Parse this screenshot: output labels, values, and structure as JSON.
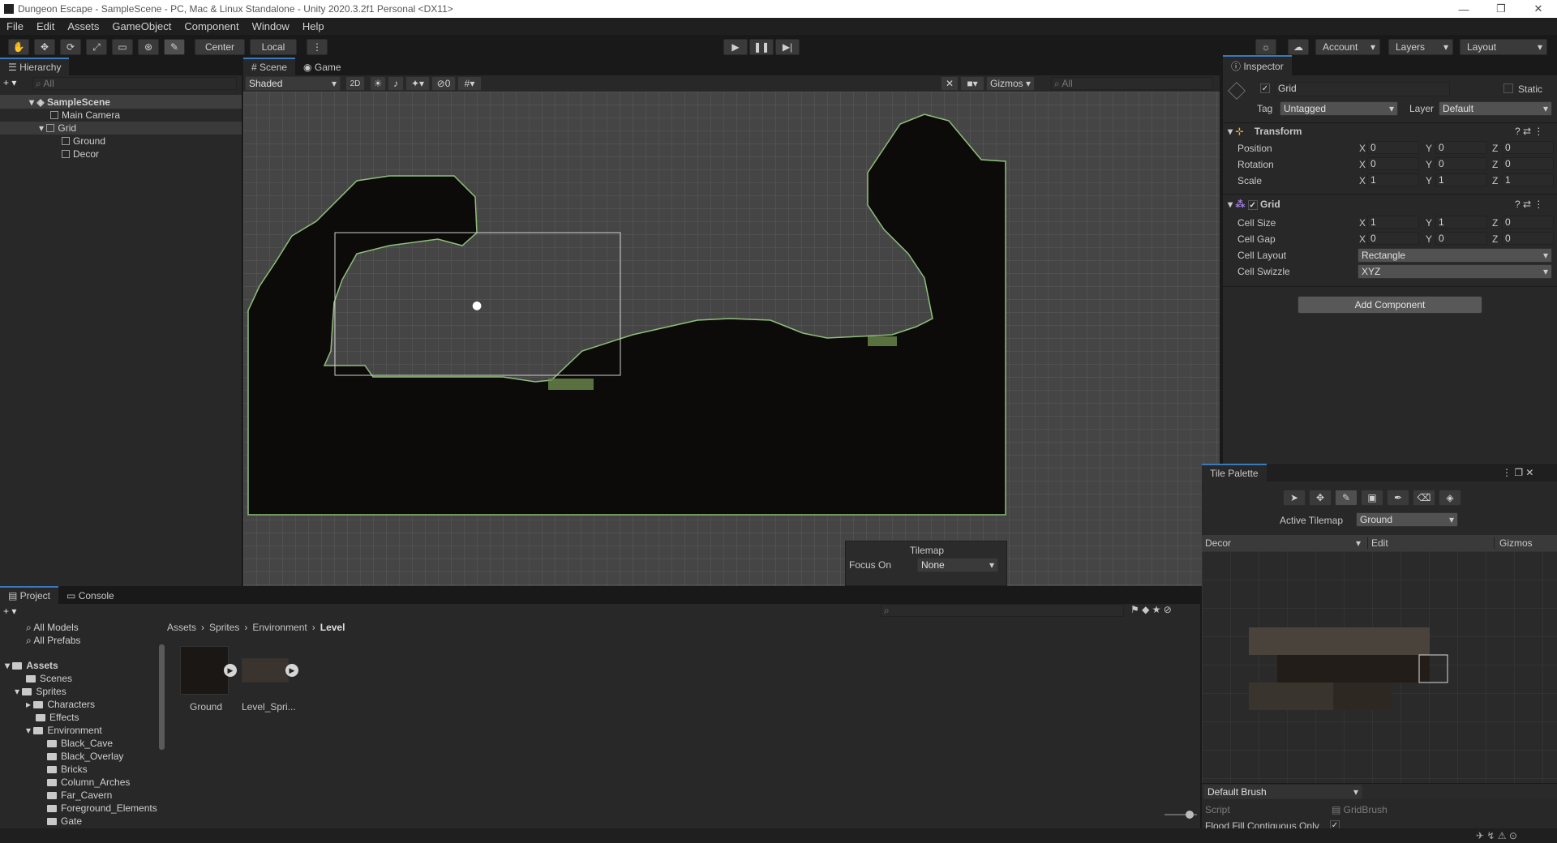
{
  "window": {
    "title": "Dungeon Escape - SampleScene - PC, Mac & Linux Standalone - Unity 2020.3.2f1 Personal <DX11>"
  },
  "menu": [
    "File",
    "Edit",
    "Assets",
    "GameObject",
    "Component",
    "Window",
    "Help"
  ],
  "toolbar": {
    "center": "Center",
    "local": "Local",
    "account": "Account",
    "layers": "Layers",
    "layout": "Layout"
  },
  "hierarchy": {
    "tab": "Hierarchy",
    "search_placeholder": "All",
    "items": [
      {
        "label": "SampleScene"
      },
      {
        "label": "Main Camera"
      },
      {
        "label": "Grid"
      },
      {
        "label": "Ground"
      },
      {
        "label": "Decor"
      }
    ]
  },
  "scene": {
    "tabs": [
      "Scene",
      "Game"
    ],
    "shading": "Shaded",
    "mode2d": "2D",
    "hidden_count": "0",
    "gizmos": "Gizmos",
    "search_placeholder": "All",
    "overlay": {
      "title": "Tilemap",
      "focus_label": "Focus On",
      "focus_value": "None"
    }
  },
  "inspector": {
    "tab": "Inspector",
    "object_name": "Grid",
    "static": "Static",
    "tag_label": "Tag",
    "tag": "Untagged",
    "layer_label": "Layer",
    "layer": "Default",
    "transform": {
      "title": "Transform",
      "position": {
        "label": "Position",
        "x": "0",
        "y": "0",
        "z": "0"
      },
      "rotation": {
        "label": "Rotation",
        "x": "0",
        "y": "0",
        "z": "0"
      },
      "scale": {
        "label": "Scale",
        "x": "1",
        "y": "1",
        "z": "1"
      }
    },
    "grid": {
      "title": "Grid",
      "cell_size": {
        "label": "Cell Size",
        "x": "1",
        "y": "1",
        "z": "0"
      },
      "cell_gap": {
        "label": "Cell Gap",
        "x": "0",
        "y": "0",
        "z": "0"
      },
      "cell_layout": {
        "label": "Cell Layout",
        "value": "Rectangle"
      },
      "cell_swizzle": {
        "label": "Cell Swizzle",
        "value": "XYZ"
      }
    },
    "axis": {
      "x": "X",
      "y": "Y",
      "z": "Z"
    },
    "add_component": "Add Component"
  },
  "tile_palette": {
    "title": "Tile Palette",
    "active_tilemap_label": "Active Tilemap",
    "active_tilemap": "Ground",
    "palette": "Decor",
    "edit": "Edit",
    "gizmos": "Gizmos",
    "brush": "Default Brush",
    "script_label": "Script",
    "script_value": "GridBrush",
    "flood_label": "Flood Fill Contiguous Only"
  },
  "project": {
    "tabs": [
      "Project",
      "Console"
    ],
    "favorites": [
      "All Models",
      "All Prefabs"
    ],
    "tree": [
      "Assets",
      "Scenes",
      "Sprites",
      "Characters",
      "Effects",
      "Environment",
      "Black_Cave",
      "Black_Overlay",
      "Bricks",
      "Column_Arches",
      "Far_Cavern",
      "Foreground_Elements",
      "Gate"
    ],
    "breadcrumb": [
      "Assets",
      "Sprites",
      "Environment",
      "Level"
    ],
    "assets": [
      "Ground",
      "Level_Spri..."
    ]
  },
  "colors": {
    "accent": "#3a79bb",
    "scene_bg": "#454545",
    "cave": "#0d0b0a",
    "edge": "#8fbf7a"
  }
}
